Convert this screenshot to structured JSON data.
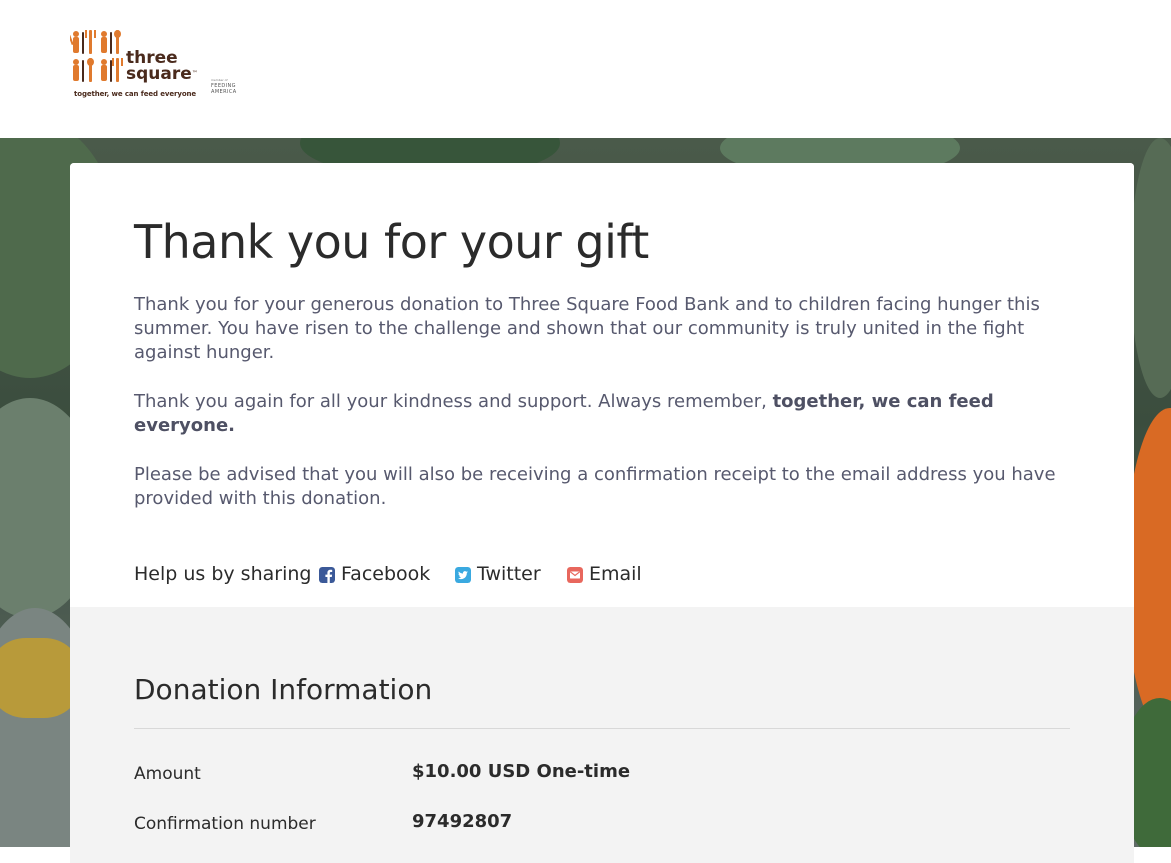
{
  "brand": {
    "name_line1": "three",
    "name_line2": "square",
    "trademark": "™",
    "tagline": "together, we can feed everyone",
    "partner_prefix": "member of",
    "partner_line1": "FEEDING",
    "partner_line2": "AMERICA",
    "color": "#e07a2e"
  },
  "thank_you": {
    "title": "Thank you for your gift",
    "paragraph1": "Thank you for your generous donation to Three Square Food Bank and to children facing hunger this summer. You have risen to the challenge and shown that our community is truly united in the fight against hunger.",
    "paragraph2_lead": "Thank you again for all your kindness and support. Always remember, ",
    "paragraph2_bold": "together, we can feed everyone.",
    "paragraph3": "Please be advised that you will also be receiving a confirmation receipt to the email address you have provided with this donation."
  },
  "share": {
    "label": "Help us by sharing",
    "facebook": "Facebook",
    "twitter": "Twitter",
    "email": "Email",
    "facebook_color": "#3b5998",
    "twitter_color": "#1da1f2",
    "email_color": "#e8675d"
  },
  "donation": {
    "section_title": "Donation Information",
    "rows": [
      {
        "label": "Amount",
        "value": "$10.00 USD One-time"
      },
      {
        "label": "Confirmation number",
        "value": "97492807"
      }
    ]
  }
}
